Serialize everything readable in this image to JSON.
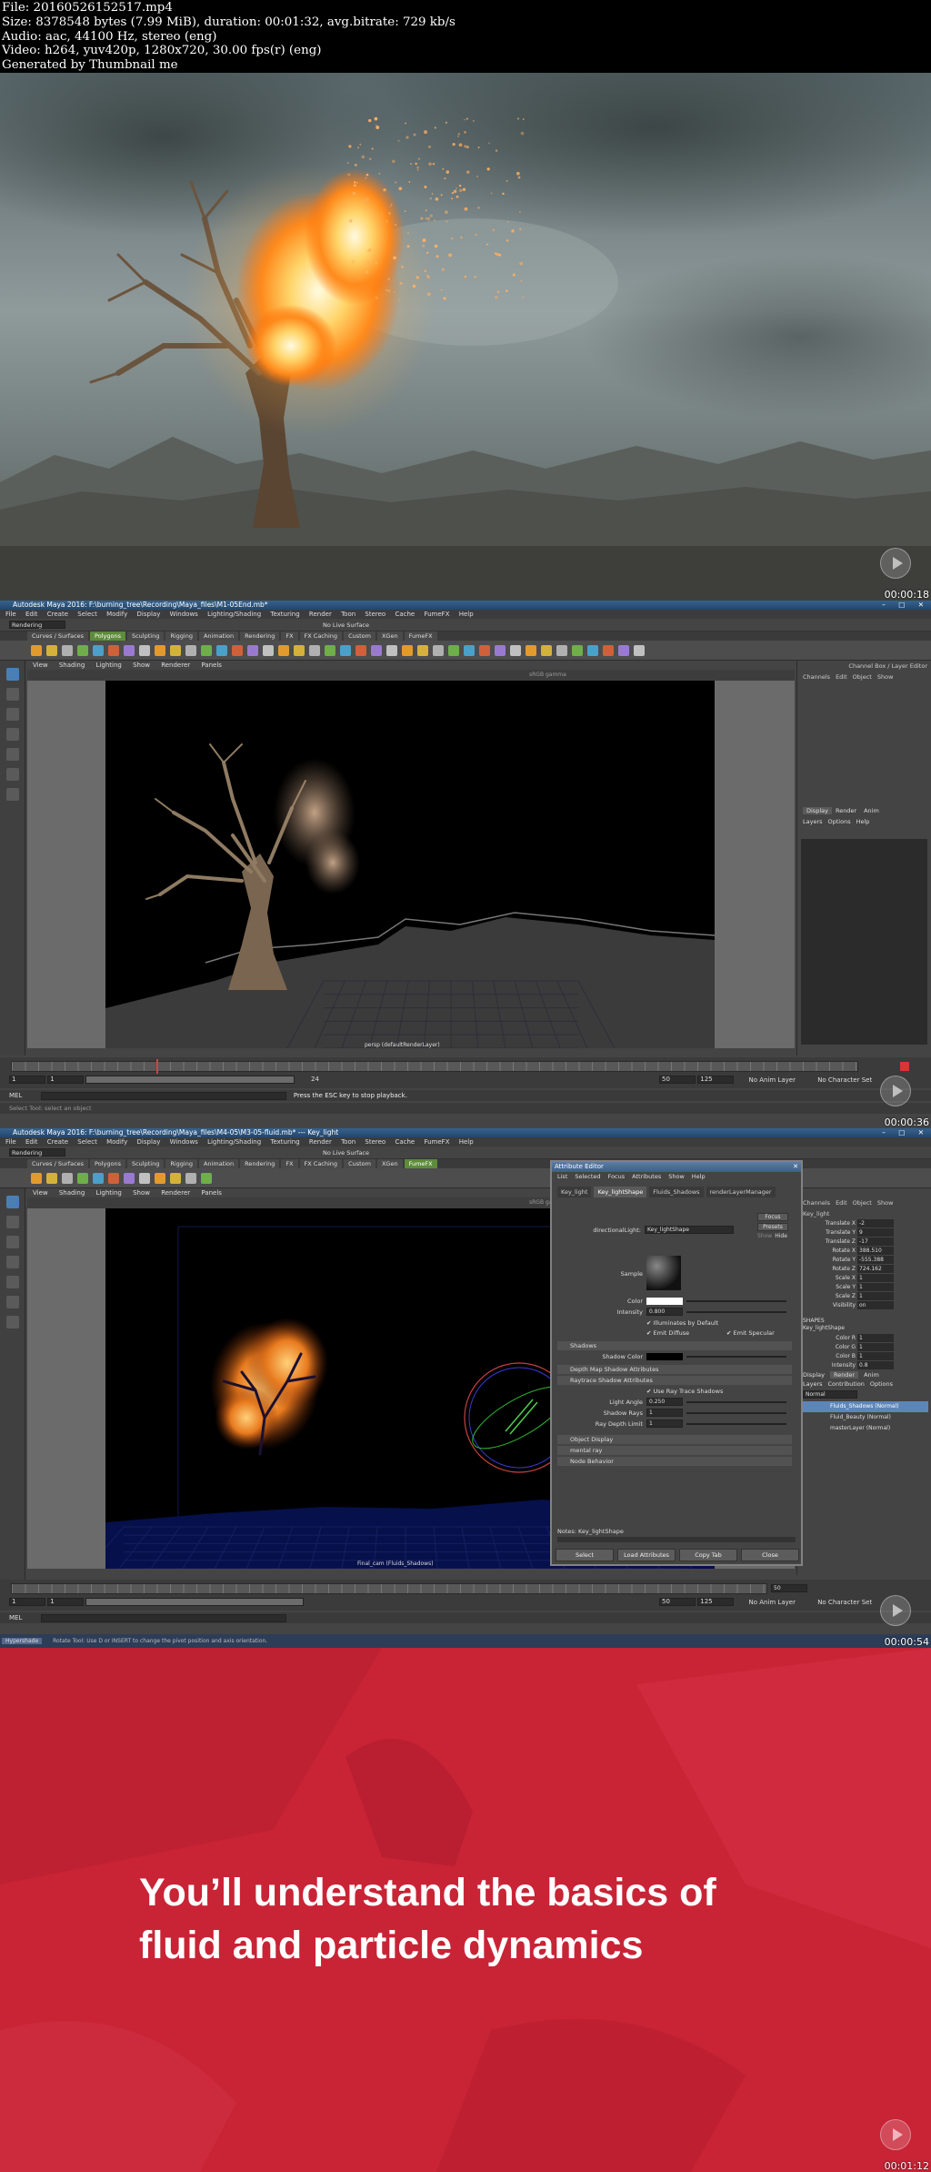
{
  "header": {
    "lines": [
      "File: 20160526152517.mp4",
      "Size: 8378548 bytes (7.99 MiB), duration: 00:01:32, avg.bitrate: 729 kb/s",
      "Audio: aac, 44100 Hz, stereo (eng)",
      "Video: h264, yuv420p, 1280x720, 30.00 fps(r) (eng)",
      "Generated by Thumbnail me"
    ]
  },
  "frames": [
    {
      "timestamp": "00:00:18"
    },
    {
      "timestamp": "00:00:36"
    },
    {
      "timestamp": "00:00:54"
    },
    {
      "timestamp": "00:01:12"
    }
  ],
  "maya1": {
    "title": "Autodesk Maya 2016: F:\\burning_tree\\Recording\\Maya_files\\M1-05End.mb*",
    "menu": [
      "File",
      "Edit",
      "Create",
      "Select",
      "Modify",
      "Display",
      "Windows",
      "Lighting/Shading",
      "Texturing",
      "Render",
      "Toon",
      "Stereo",
      "Cache",
      "FumeFX",
      "Help"
    ],
    "mode": "Rendering",
    "live_surface": "No Live Surface",
    "shelf_tabs": [
      "Curves / Surfaces",
      "Polygons",
      "Sculpting",
      "Rigging",
      "Animation",
      "Rendering",
      "FX",
      "FX Caching",
      "Custom",
      "XGen",
      "FumeFX"
    ],
    "viewport_menu": [
      "View",
      "Shading",
      "Lighting",
      "Show",
      "Renderer",
      "Panels"
    ],
    "gamma": "sRGB gamma",
    "camera_label": "persp (defaultRenderLayer)",
    "channel_box_title": "Channel Box / Layer Editor",
    "channel_tabs": [
      "Channels",
      "Edit",
      "Object",
      "Show"
    ],
    "layer_tabs": [
      "Display",
      "Render",
      "Anim"
    ],
    "layer_menu": [
      "Layers",
      "Options",
      "Help"
    ],
    "time_start": "1",
    "time_end": "125",
    "range_a": "1",
    "range_b": "125",
    "range_c": "24",
    "range_d": "50",
    "anim_layer": "No Anim Layer",
    "char_set": "No Character Set",
    "cmd_label": "MEL",
    "help_text": "Press the ESC key to stop playback.",
    "status_text": "Select Tool: select an object"
  },
  "maya2": {
    "title": "Autodesk Maya 2016: F:\\burning_tree\\Recording\\Maya_files\\M4-05\\M3-05-fluid.mb*  ---  Key_light",
    "menu": [
      "File",
      "Edit",
      "Create",
      "Select",
      "Modify",
      "Display",
      "Windows",
      "Lighting/Shading",
      "Texturing",
      "Render",
      "Toon",
      "Stereo",
      "Cache",
      "FumeFX",
      "Help"
    ],
    "mode": "Rendering",
    "live_surface": "No Live Surface",
    "shelf_tabs": [
      "Curves / Surfaces",
      "Polygons",
      "Sculpting",
      "Rigging",
      "Animation",
      "Rendering",
      "FX",
      "FX Caching",
      "Custom",
      "XGen",
      "FumeFX"
    ],
    "viewport_menu": [
      "View",
      "Shading",
      "Lighting",
      "Show",
      "Renderer",
      "Panels"
    ],
    "gamma": "sRGB gamma",
    "camera_label": "Final_cam (Fluids_Shadows)",
    "ae": {
      "title": "Attribute Editor",
      "menu": [
        "List",
        "Selected",
        "Focus",
        "Attributes",
        "Show",
        "Help"
      ],
      "tabs": [
        "Key_light",
        "Key_lightShape",
        "Fluids_Shadows",
        "renderLayerManager"
      ],
      "node_label": "directionalLight:",
      "node_value": "Key_lightShape",
      "focus": "Focus",
      "presets": "Presets",
      "show": "Show",
      "hide": "Hide",
      "sample": "Sample",
      "color": "Color",
      "intensity_label": "Intensity",
      "intensity": "0.800",
      "illum_default": "Illuminates by Default",
      "emit_diffuse": "Emit Diffuse",
      "emit_specular": "Emit Specular",
      "shadows": "Shadows",
      "shadow_color": "Shadow Color",
      "depth_map": "Depth Map Shadow Attributes",
      "raytrace": "Raytrace Shadow Attributes",
      "use_ray": "Use Ray Trace Shadows",
      "light_angle_label": "Light Angle",
      "light_angle": "0.250",
      "shadow_rays_label": "Shadow Rays",
      "shadow_rays": "1",
      "ray_depth_label": "Ray Depth Limit",
      "ray_depth": "1",
      "object_display": "Object Display",
      "mental_ray": "mental ray",
      "node_behavior": "Node Behavior",
      "notes": "Notes: Key_lightShape",
      "btn_select": "Select",
      "btn_load": "Load Attributes",
      "btn_copy": "Copy Tab",
      "btn_close": "Close"
    },
    "channel_tabs": [
      "Channels",
      "Edit",
      "Object",
      "Show"
    ],
    "node_name": "Key_light",
    "channels": [
      [
        "Translate X",
        "-2"
      ],
      [
        "Translate Y",
        "9"
      ],
      [
        "Translate Z",
        "-17"
      ],
      [
        "Rotate X",
        "388.510"
      ],
      [
        "Rotate Y",
        "-555.388"
      ],
      [
        "Rotate Z",
        "724.162"
      ],
      [
        "Scale X",
        "1"
      ],
      [
        "Scale Y",
        "1"
      ],
      [
        "Scale Z",
        "1"
      ],
      [
        "Visibility",
        "on"
      ]
    ],
    "shapes_label": "SHAPES",
    "shape_name": "Key_lightShape",
    "shape_channels": [
      [
        "Color R",
        "1"
      ],
      [
        "Color G",
        "1"
      ],
      [
        "Color B",
        "1"
      ],
      [
        "Intensity",
        "0.8"
      ]
    ],
    "layer_tabs": [
      "Display",
      "Render",
      "Anim"
    ],
    "layer_menu": [
      "Layers",
      "Contribution",
      "Options"
    ],
    "layer_mode": "Normal",
    "layers": [
      "Fluids_Shadows (Normal)",
      "Fluid_Beauty (Normal)",
      "masterLayer (Normal)"
    ],
    "time_a": "1",
    "time_b": "1",
    "frame_cur": "50",
    "range_c": "50",
    "range_d": "125",
    "anim_layer": "No Anim Layer",
    "char_set": "No Character Set",
    "cmd_label": "MEL",
    "help_text": "Rotate Tool: Use D or INSERT to change the pivot position and axis orientation.",
    "taskbar_item": "Hypershade"
  },
  "promo": {
    "line1": "You’ll understand the basics of",
    "line2": "fluid and particle dynamics"
  }
}
